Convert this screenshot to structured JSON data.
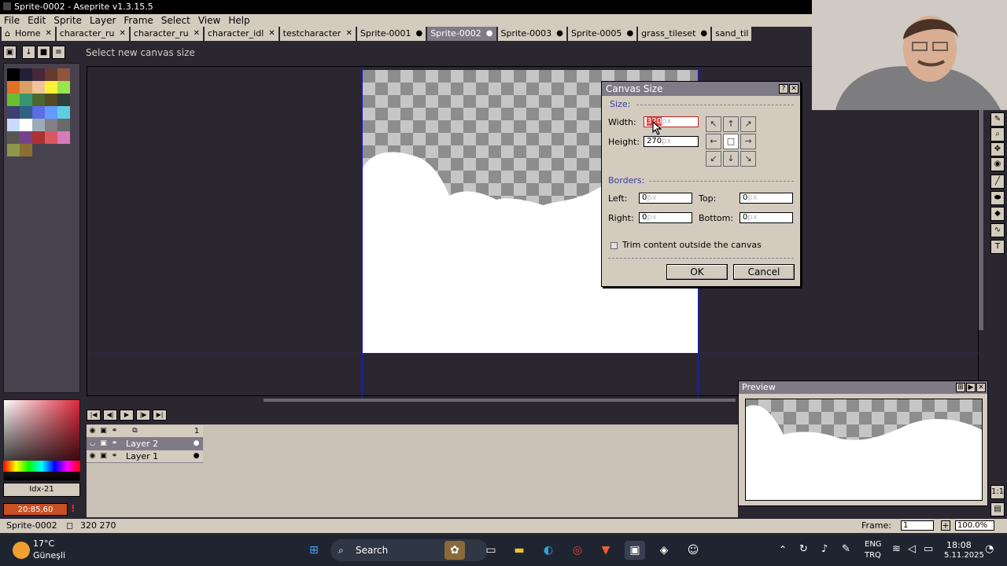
{
  "window": {
    "title": "Sprite-0002 - Aseprite v1.3.15.5"
  },
  "menu": [
    "File",
    "Edit",
    "Sprite",
    "Layer",
    "Frame",
    "Select",
    "View",
    "Help"
  ],
  "tabs": [
    {
      "label": "Home",
      "close": "✕"
    },
    {
      "label": "character_ru",
      "close": "✕"
    },
    {
      "label": "character_ru",
      "close": "✕"
    },
    {
      "label": "character_idl",
      "close": "✕"
    },
    {
      "label": "testcharacter",
      "close": "✕"
    },
    {
      "label": "Sprite-0001",
      "close": "●"
    },
    {
      "label": "Sprite-0002",
      "close": "●"
    },
    {
      "label": "Sprite-0003",
      "close": "●"
    },
    {
      "label": "Sprite-0005",
      "close": "●"
    },
    {
      "label": "grass_tileset",
      "close": "●"
    },
    {
      "label": "sand_til",
      "close": ""
    }
  ],
  "toolbar": {
    "hint": "Select new canvas size"
  },
  "color_panel": {
    "index_label": "Idx-21",
    "fg_color_label": "20:85,60"
  },
  "dialog": {
    "title": "Canvas Size",
    "size_section": "Size:",
    "width_label": "Width:",
    "width_value": "320",
    "width_unit": "px",
    "height_label": "Height:",
    "height_value": "270",
    "height_unit": "px",
    "borders_section": "Borders:",
    "left_label": "Left:",
    "left_value": "0",
    "top_label": "Top:",
    "top_value": "0",
    "right_label": "Right:",
    "right_value": "0",
    "bottom_label": "Bottom:",
    "bottom_value": "0",
    "unit": "px",
    "trim_label": "Trim content outside the canvas",
    "trim_checked": false,
    "ok_label": "OK",
    "cancel_label": "Cancel"
  },
  "timeline": {
    "frame_number": "1",
    "layers": [
      {
        "name": "Layer 2",
        "selected": true
      },
      {
        "name": "Layer 1",
        "selected": false
      }
    ]
  },
  "preview": {
    "title": "Preview"
  },
  "status": {
    "sprite": "Sprite-0002",
    "size": "320 270",
    "frame_label": "Frame:",
    "frame_value": "1",
    "zoom": "100.0%"
  },
  "taskbar": {
    "weather_temp": "17°C",
    "weather_desc": "Güneşli",
    "search_label": "Search",
    "lang1": "ENG",
    "lang2": "TRQ",
    "time": "18:08",
    "date": "5.11.2025"
  },
  "colors": {
    "accent": "#7e7a86",
    "panel": "#d3cbbe",
    "bg": "#2b2731",
    "grid": "#1a1acc"
  }
}
